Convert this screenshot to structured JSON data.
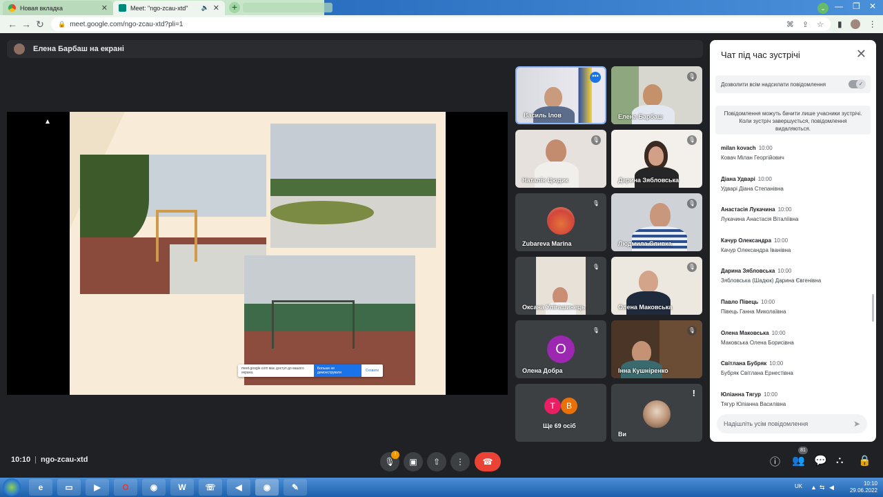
{
  "browser": {
    "tabs": [
      {
        "label": "Новая вкладка",
        "close": "✕"
      },
      {
        "label": "Meet: \"ngo-zcau-xtd\"",
        "close": "✕"
      }
    ],
    "new_tab": "+",
    "tab_menu": "⌄",
    "window_controls": [
      "—",
      "❐",
      "✕"
    ],
    "url": "meet.google.com/ngo-zcau-xtd?pli=1"
  },
  "presenter_bar": {
    "label": "Елена Барбаш на екрані"
  },
  "share_notice": {
    "text": "meet.google.com має доступ до вашого екрана.",
    "stop": "Больше не демонструвати",
    "hide": "Сховати"
  },
  "tiles": [
    {
      "name": "Василь Ілов",
      "muted": false,
      "more": true
    },
    {
      "name": "Елена Барбаш",
      "muted": true
    },
    {
      "name": "Наталія Цюдик",
      "muted": true
    },
    {
      "name": "Дарина Зябловська",
      "muted": true
    },
    {
      "name": "Zubareva Marina",
      "muted": true
    },
    {
      "name": "Людмила Сливка",
      "muted": true
    },
    {
      "name": "Оксана Улігашинець",
      "muted": true
    },
    {
      "name": "Олена Маковська",
      "muted": true
    },
    {
      "name": "Олена Добра",
      "muted": true,
      "initial": "О"
    },
    {
      "name": "Інна Кушніренко",
      "muted": true
    },
    {
      "name": "Ще 69 осіб",
      "initials": [
        "T",
        "B"
      ]
    },
    {
      "name": "Ви",
      "alert": "!"
    }
  ],
  "chat": {
    "title": "Чат під час зустрічі",
    "close": "✕",
    "allow_label": "Дозволити всім надсилати повідомлення",
    "info": "Повідомлення можуть бачити лише учасники зустрічі. Коли зустріч завершується, повідомлення видаляються.",
    "messages": [
      {
        "sender": "milan kovach",
        "time": "10:00",
        "text": "Ковач Мілан Георгійович"
      },
      {
        "sender": "Діана Удварі",
        "time": "10:00",
        "text": "Удварі Діана Степанівна"
      },
      {
        "sender": "Анастасія Лукачина",
        "time": "10:00",
        "text": "Лукачина Анастасія Віталіївна"
      },
      {
        "sender": "Качур Олександра",
        "time": "10:00",
        "text": "Качур Олександра Іванівна"
      },
      {
        "sender": "Дарина Зябловська",
        "time": "10:00",
        "text": "Зябловська (Шадюк) Дарина Євгенівна"
      },
      {
        "sender": "Павло Півець",
        "time": "10:00",
        "text": "Півець Ганна Миколаївна"
      },
      {
        "sender": "Олена Маковська",
        "time": "10:00",
        "text": "Маковська Олена Борисівна"
      },
      {
        "sender": "Світлана Бубряк",
        "time": "10:00",
        "text": "Бубряк Світлана Ернестівна"
      },
      {
        "sender": "Юліанна Тягур",
        "time": "10:00",
        "text": "Тягур Юліанна Василівна"
      }
    ],
    "input_placeholder": "Надішліть усім повідомлення"
  },
  "meeting": {
    "time": "10:10",
    "separator": "|",
    "code": "ngo-zcau-xtd",
    "mic_badge": "!",
    "participants_count": "81"
  },
  "taskbar": {
    "language": "UK",
    "time": "10:10",
    "date": "29.06.2022"
  },
  "colors": {
    "meet_bg": "#202124",
    "end_call": "#ea4335",
    "accent": "#1a73e8",
    "chat_icon_active": "#8ab4f8"
  }
}
